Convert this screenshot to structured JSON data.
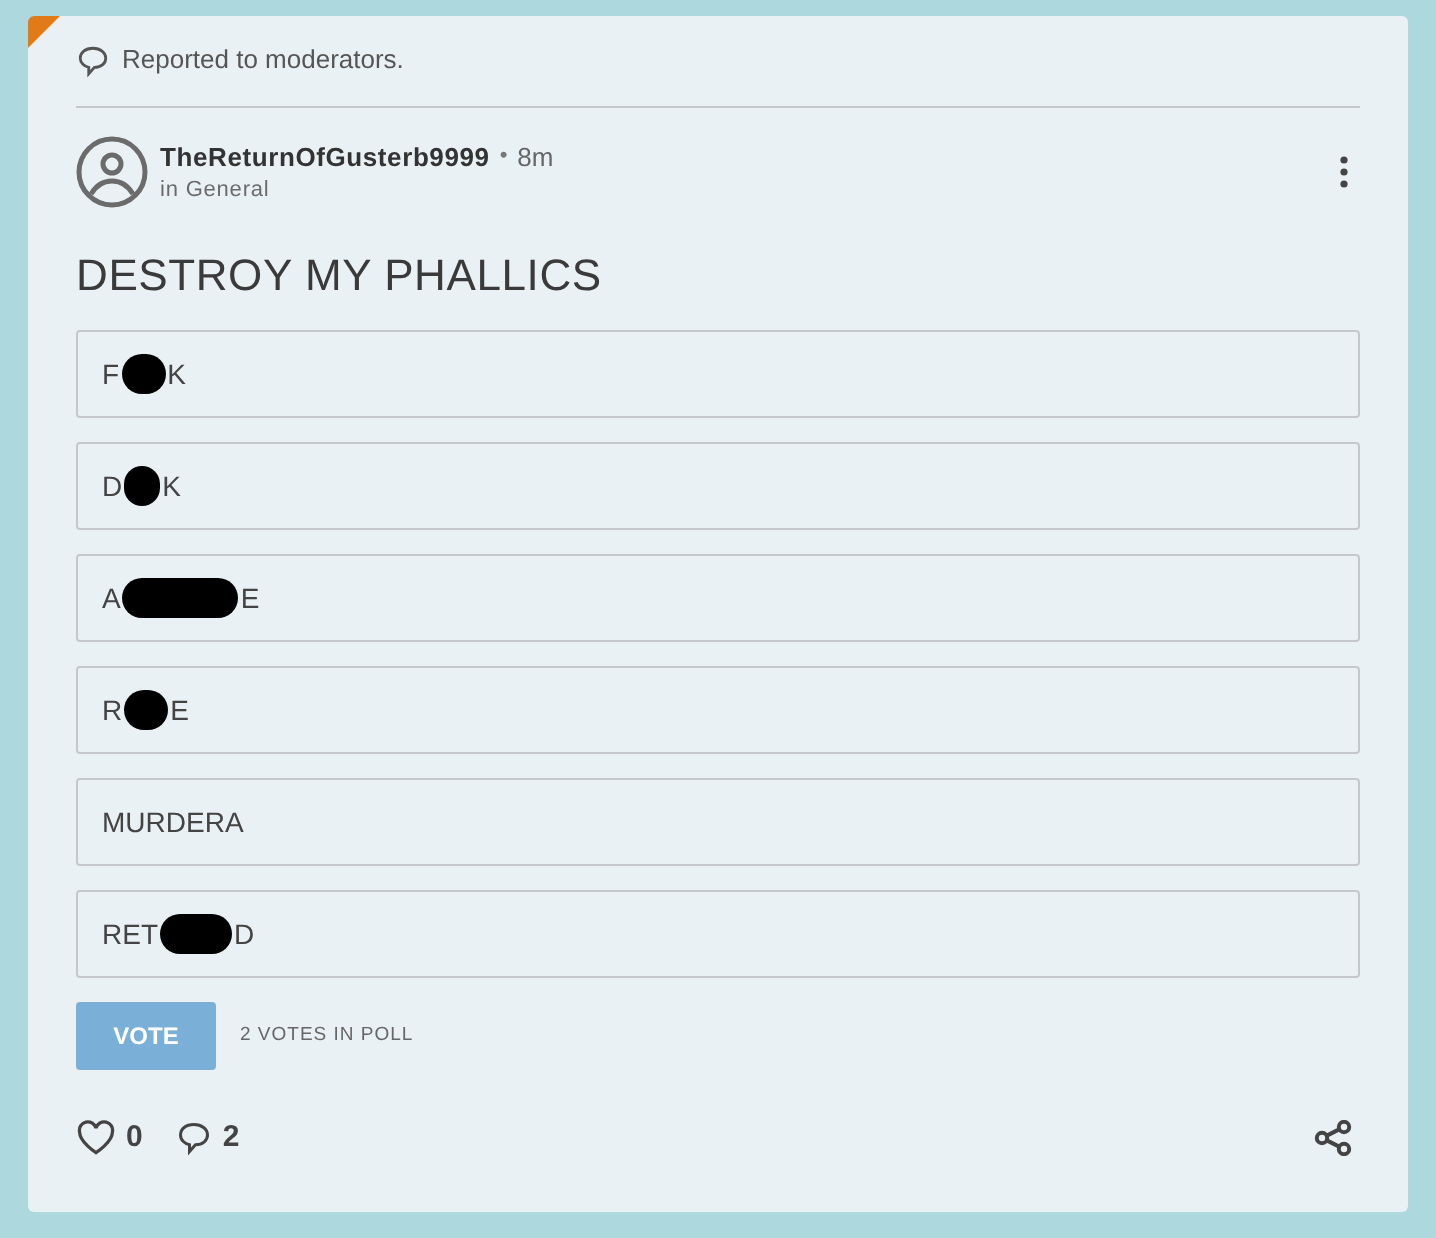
{
  "report_notice": "Reported to moderators.",
  "post": {
    "author": "TheReturnOfGusterb9999",
    "separator": "•",
    "time": "8m",
    "category": "in General",
    "title": "DESTROY MY PHALLICS"
  },
  "poll": {
    "options": [
      {
        "visible_start": "F",
        "visible_end": "K",
        "redacted": true
      },
      {
        "visible_start": "D",
        "visible_end": "K",
        "redacted": true
      },
      {
        "visible_start": "A",
        "visible_end": "E",
        "redacted": true
      },
      {
        "visible_start": "R",
        "visible_end": "E",
        "redacted": true
      },
      {
        "visible_start": "MURDERA",
        "redacted": false
      },
      {
        "visible_start": "RET",
        "visible_end": "D",
        "redacted": true
      }
    ],
    "vote_button": "VOTE",
    "vote_count": "2 VOTES IN POLL"
  },
  "footer": {
    "likes": "0",
    "comments": "2"
  }
}
